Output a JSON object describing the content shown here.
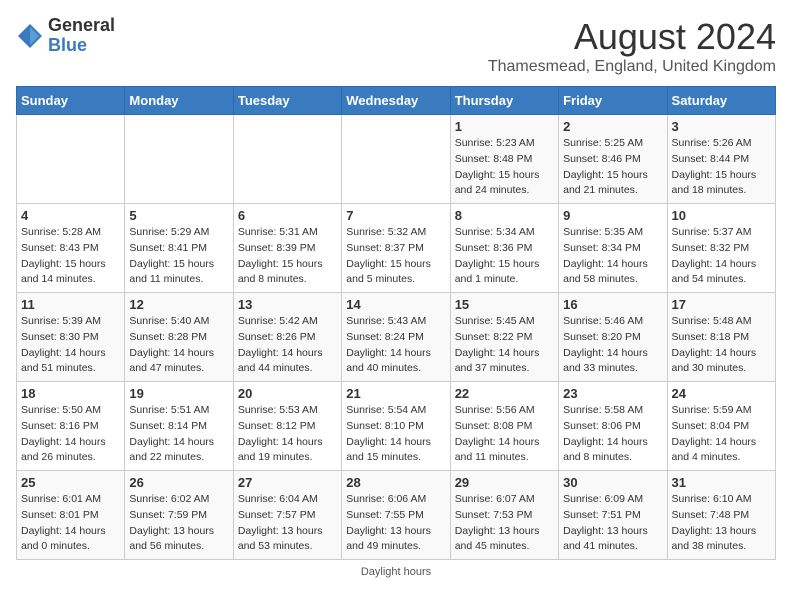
{
  "logo": {
    "general": "General",
    "blue": "Blue"
  },
  "header": {
    "title": "August 2024",
    "subtitle": "Thamesmead, England, United Kingdom"
  },
  "days_of_week": [
    "Sunday",
    "Monday",
    "Tuesday",
    "Wednesday",
    "Thursday",
    "Friday",
    "Saturday"
  ],
  "weeks": [
    [
      {
        "day": "",
        "detail": ""
      },
      {
        "day": "",
        "detail": ""
      },
      {
        "day": "",
        "detail": ""
      },
      {
        "day": "",
        "detail": ""
      },
      {
        "day": "1",
        "detail": "Sunrise: 5:23 AM\nSunset: 8:48 PM\nDaylight: 15 hours\nand 24 minutes."
      },
      {
        "day": "2",
        "detail": "Sunrise: 5:25 AM\nSunset: 8:46 PM\nDaylight: 15 hours\nand 21 minutes."
      },
      {
        "day": "3",
        "detail": "Sunrise: 5:26 AM\nSunset: 8:44 PM\nDaylight: 15 hours\nand 18 minutes."
      }
    ],
    [
      {
        "day": "4",
        "detail": "Sunrise: 5:28 AM\nSunset: 8:43 PM\nDaylight: 15 hours\nand 14 minutes."
      },
      {
        "day": "5",
        "detail": "Sunrise: 5:29 AM\nSunset: 8:41 PM\nDaylight: 15 hours\nand 11 minutes."
      },
      {
        "day": "6",
        "detail": "Sunrise: 5:31 AM\nSunset: 8:39 PM\nDaylight: 15 hours\nand 8 minutes."
      },
      {
        "day": "7",
        "detail": "Sunrise: 5:32 AM\nSunset: 8:37 PM\nDaylight: 15 hours\nand 5 minutes."
      },
      {
        "day": "8",
        "detail": "Sunrise: 5:34 AM\nSunset: 8:36 PM\nDaylight: 15 hours\nand 1 minute."
      },
      {
        "day": "9",
        "detail": "Sunrise: 5:35 AM\nSunset: 8:34 PM\nDaylight: 14 hours\nand 58 minutes."
      },
      {
        "day": "10",
        "detail": "Sunrise: 5:37 AM\nSunset: 8:32 PM\nDaylight: 14 hours\nand 54 minutes."
      }
    ],
    [
      {
        "day": "11",
        "detail": "Sunrise: 5:39 AM\nSunset: 8:30 PM\nDaylight: 14 hours\nand 51 minutes."
      },
      {
        "day": "12",
        "detail": "Sunrise: 5:40 AM\nSunset: 8:28 PM\nDaylight: 14 hours\nand 47 minutes."
      },
      {
        "day": "13",
        "detail": "Sunrise: 5:42 AM\nSunset: 8:26 PM\nDaylight: 14 hours\nand 44 minutes."
      },
      {
        "day": "14",
        "detail": "Sunrise: 5:43 AM\nSunset: 8:24 PM\nDaylight: 14 hours\nand 40 minutes."
      },
      {
        "day": "15",
        "detail": "Sunrise: 5:45 AM\nSunset: 8:22 PM\nDaylight: 14 hours\nand 37 minutes."
      },
      {
        "day": "16",
        "detail": "Sunrise: 5:46 AM\nSunset: 8:20 PM\nDaylight: 14 hours\nand 33 minutes."
      },
      {
        "day": "17",
        "detail": "Sunrise: 5:48 AM\nSunset: 8:18 PM\nDaylight: 14 hours\nand 30 minutes."
      }
    ],
    [
      {
        "day": "18",
        "detail": "Sunrise: 5:50 AM\nSunset: 8:16 PM\nDaylight: 14 hours\nand 26 minutes."
      },
      {
        "day": "19",
        "detail": "Sunrise: 5:51 AM\nSunset: 8:14 PM\nDaylight: 14 hours\nand 22 minutes."
      },
      {
        "day": "20",
        "detail": "Sunrise: 5:53 AM\nSunset: 8:12 PM\nDaylight: 14 hours\nand 19 minutes."
      },
      {
        "day": "21",
        "detail": "Sunrise: 5:54 AM\nSunset: 8:10 PM\nDaylight: 14 hours\nand 15 minutes."
      },
      {
        "day": "22",
        "detail": "Sunrise: 5:56 AM\nSunset: 8:08 PM\nDaylight: 14 hours\nand 11 minutes."
      },
      {
        "day": "23",
        "detail": "Sunrise: 5:58 AM\nSunset: 8:06 PM\nDaylight: 14 hours\nand 8 minutes."
      },
      {
        "day": "24",
        "detail": "Sunrise: 5:59 AM\nSunset: 8:04 PM\nDaylight: 14 hours\nand 4 minutes."
      }
    ],
    [
      {
        "day": "25",
        "detail": "Sunrise: 6:01 AM\nSunset: 8:01 PM\nDaylight: 14 hours\nand 0 minutes."
      },
      {
        "day": "26",
        "detail": "Sunrise: 6:02 AM\nSunset: 7:59 PM\nDaylight: 13 hours\nand 56 minutes."
      },
      {
        "day": "27",
        "detail": "Sunrise: 6:04 AM\nSunset: 7:57 PM\nDaylight: 13 hours\nand 53 minutes."
      },
      {
        "day": "28",
        "detail": "Sunrise: 6:06 AM\nSunset: 7:55 PM\nDaylight: 13 hours\nand 49 minutes."
      },
      {
        "day": "29",
        "detail": "Sunrise: 6:07 AM\nSunset: 7:53 PM\nDaylight: 13 hours\nand 45 minutes."
      },
      {
        "day": "30",
        "detail": "Sunrise: 6:09 AM\nSunset: 7:51 PM\nDaylight: 13 hours\nand 41 minutes."
      },
      {
        "day": "31",
        "detail": "Sunrise: 6:10 AM\nSunset: 7:48 PM\nDaylight: 13 hours\nand 38 minutes."
      }
    ]
  ],
  "footer": {
    "note": "Daylight hours"
  }
}
